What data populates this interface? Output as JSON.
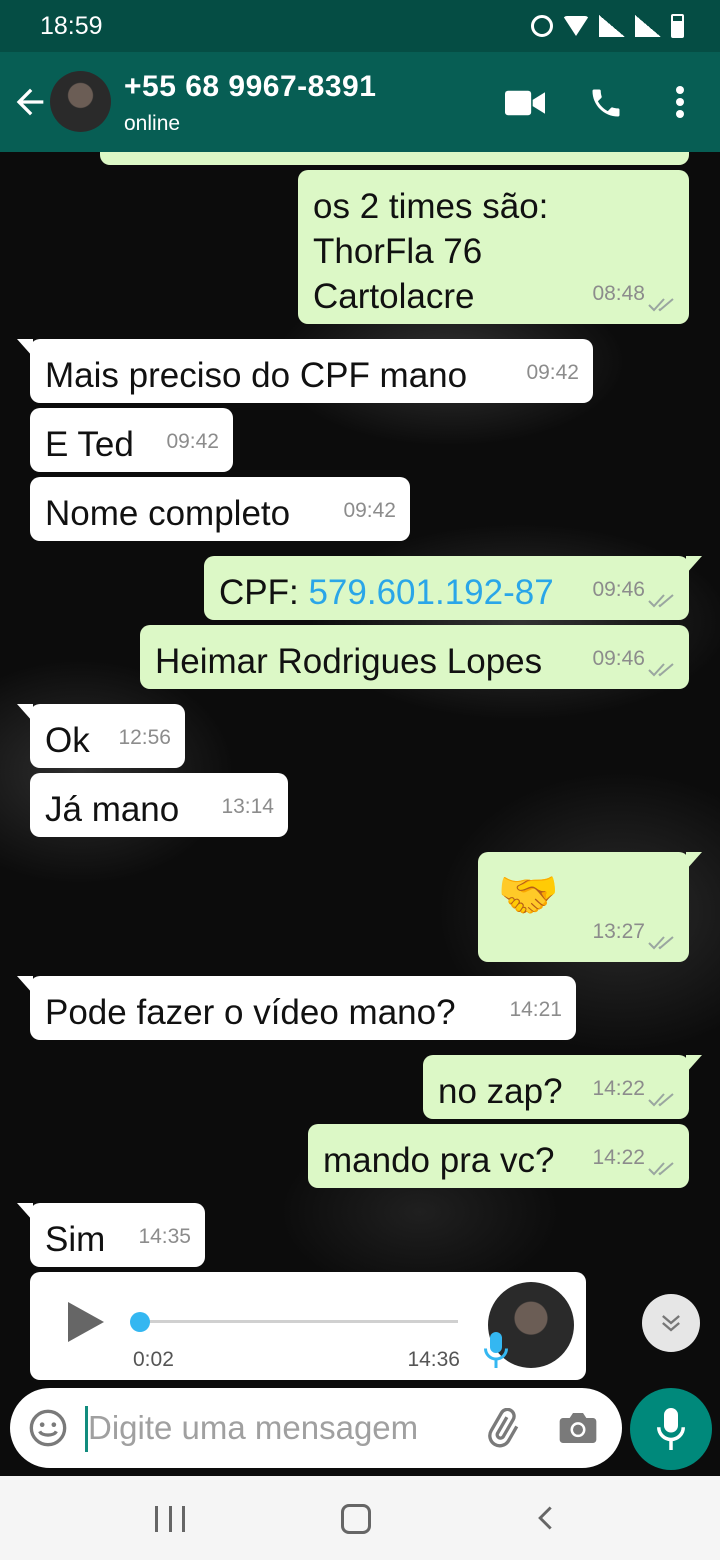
{
  "status_bar": {
    "time": "18:59"
  },
  "header": {
    "contact_name": "+55 68 9967-8391",
    "contact_status": "online"
  },
  "messages": [
    {
      "dir": "out",
      "text": "os 2 times são:\nThorFla 76\nCartolacre",
      "time": "08:48",
      "read": true
    },
    {
      "dir": "in",
      "text": "Mais preciso do CPF mano",
      "time": "09:42"
    },
    {
      "dir": "in",
      "text": "E Ted",
      "time": "09:42"
    },
    {
      "dir": "in",
      "text": "Nome completo",
      "time": "09:42"
    },
    {
      "dir": "out",
      "text_prefix": "CPF: ",
      "link": "579.601.192-87",
      "time": "09:46",
      "read": true
    },
    {
      "dir": "out",
      "text": "Heimar Rodrigues Lopes",
      "time": "09:46",
      "read": true
    },
    {
      "dir": "in",
      "text": "Ok",
      "time": "12:56"
    },
    {
      "dir": "in",
      "text": "Já mano",
      "time": "13:14"
    },
    {
      "dir": "out",
      "emoji": "🤝",
      "time": "13:27",
      "read": true
    },
    {
      "dir": "in",
      "text": "Pode fazer o vídeo mano?",
      "time": "14:21"
    },
    {
      "dir": "out",
      "text": "no zap?",
      "time": "14:22",
      "read": true
    },
    {
      "dir": "out",
      "text": "mando pra vc?",
      "time": "14:22",
      "read": true
    },
    {
      "dir": "in",
      "text": "Sim",
      "time": "14:35"
    }
  ],
  "voice_message": {
    "duration": "0:02",
    "time": "14:36",
    "progress": 0
  },
  "composer": {
    "placeholder": "Digite uma mensagem"
  },
  "colors": {
    "header": "#075e54",
    "status_bar": "#054d44",
    "outgoing_bubble": "#dcf8c6",
    "incoming_bubble": "#ffffff",
    "accent": "#00897b",
    "link": "#2aa6e8",
    "read_check": "#9aa6a0"
  },
  "icons": [
    "back-arrow-icon",
    "video-call-icon",
    "voice-call-icon",
    "menu-icon",
    "play-icon",
    "mic-icon",
    "emoji-icon",
    "attach-icon",
    "camera-icon",
    "scroll-down-icon"
  ]
}
